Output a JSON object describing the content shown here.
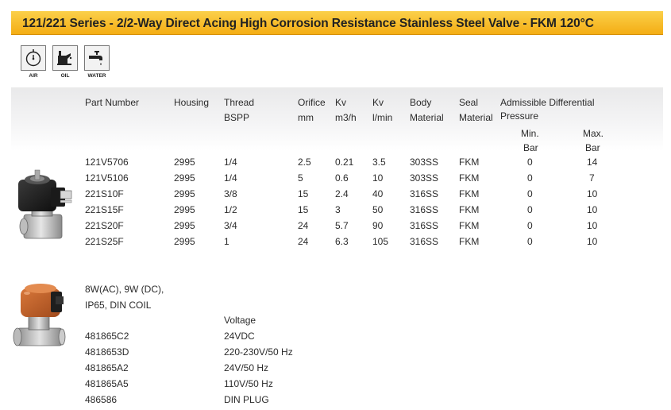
{
  "title": "121/221 Series - 2/2-Way Direct Acing High Corrosion Resistance Stainless Steel Valve - FKM  120°C",
  "media_icons": [
    {
      "label": "AIR",
      "icon": "pressure-gauge-icon"
    },
    {
      "label": "OIL",
      "icon": "oil-can-icon"
    },
    {
      "label": "WATER",
      "icon": "water-tap-icon"
    }
  ],
  "table": {
    "headers": {
      "part_number": "Part Number",
      "housing": "Housing",
      "thread": "Thread",
      "bspp": "BSPP",
      "orifice": "Orifice",
      "orifice_unit": "mm",
      "kv1": "Kv",
      "kv1_unit": "m3/h",
      "kv2": "Kv",
      "kv2_unit": "l/min",
      "body": "Body",
      "body_sub": "Material",
      "seal": "Seal",
      "seal_sub": "Material",
      "adp": "Admissible Differential",
      "adp_sub": "Pressure",
      "min": "Min.",
      "min_unit": "Bar",
      "max": "Max.",
      "max_unit": "Bar"
    },
    "rows": [
      {
        "part": "121V5706",
        "housing": "2995",
        "thread": "1/4",
        "orifice": "2.5",
        "kv_m3h": "0.21",
        "kv_lmin": "3.5",
        "body": "303SS",
        "seal": "FKM",
        "min": "0",
        "max": "14"
      },
      {
        "part": "121V5106",
        "housing": "2995",
        "thread": "1/4",
        "orifice": "5",
        "kv_m3h": "0.6",
        "kv_lmin": "10",
        "body": "303SS",
        "seal": "FKM",
        "min": "0",
        "max": "7"
      },
      {
        "part": "221S10F",
        "housing": "2995",
        "thread": "3/8",
        "orifice": "15",
        "kv_m3h": "2.4",
        "kv_lmin": "40",
        "body": "316SS",
        "seal": "FKM",
        "min": "0",
        "max": "10"
      },
      {
        "part": "221S15F",
        "housing": "2995",
        "thread": "1/2",
        "orifice": "15",
        "kv_m3h": "3",
        "kv_lmin": "50",
        "body": "316SS",
        "seal": "FKM",
        "min": "0",
        "max": "10"
      },
      {
        "part": "221S20F",
        "housing": "2995",
        "thread": "3/4",
        "orifice": "24",
        "kv_m3h": "5.7",
        "kv_lmin": "90",
        "body": "316SS",
        "seal": "FKM",
        "min": "0",
        "max": "10"
      },
      {
        "part": "221S25F",
        "housing": "2995",
        "thread": "1",
        "orifice": "24",
        "kv_m3h": "6.3",
        "kv_lmin": "105",
        "body": "316SS",
        "seal": "FKM",
        "min": "0",
        "max": "10"
      }
    ]
  },
  "coils": {
    "description_lines": [
      "8W(AC), 9W (DC),",
      "IP65, DIN COIL"
    ],
    "voltage_header": "Voltage",
    "items": [
      {
        "part": "481865C2",
        "voltage": "24VDC"
      },
      {
        "part": "4818653D",
        "voltage": "220-230V/50 Hz"
      },
      {
        "part": "481865A2",
        "voltage": "24V/50 Hz"
      },
      {
        "part": "481865A5",
        "voltage": "110V/50 Hz"
      },
      {
        "part": "486586",
        "voltage": "DIN PLUG"
      }
    ]
  },
  "colors": {
    "title_bar_top": "#fbd04a",
    "title_bar_bottom": "#f4ad14",
    "coil_orange": "#c8602a",
    "coil_black": "#1c1c1c"
  }
}
